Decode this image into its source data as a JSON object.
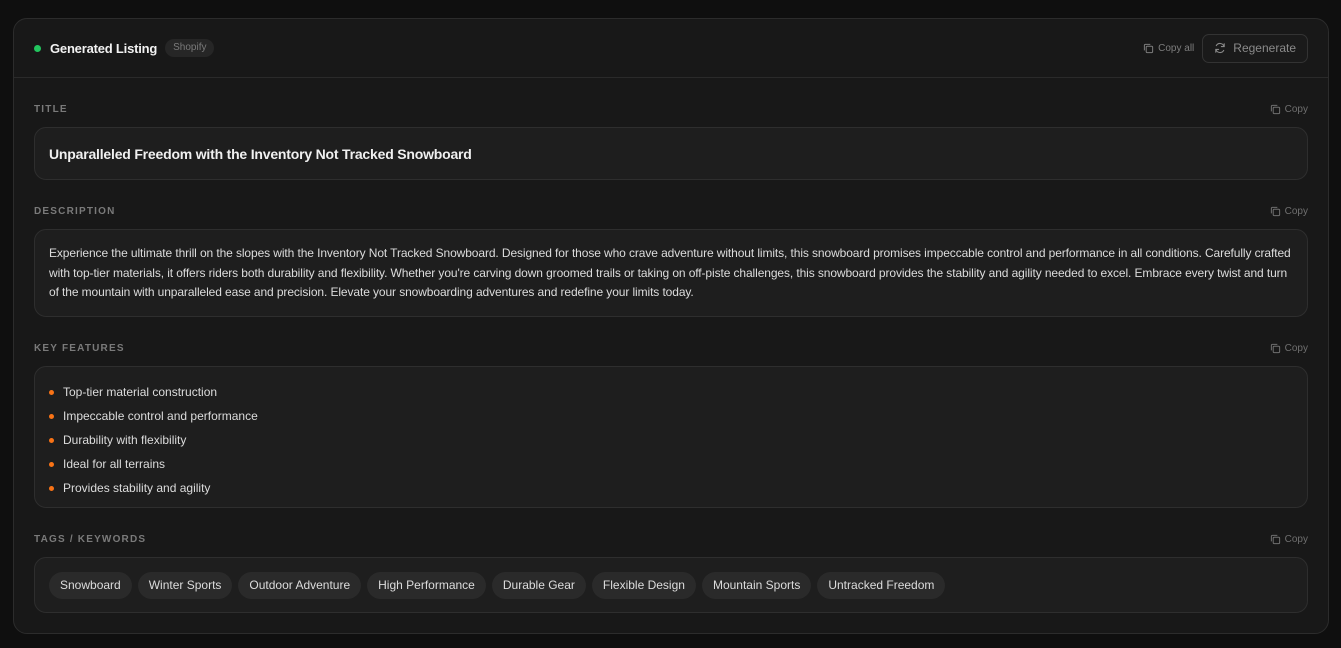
{
  "header": {
    "title": "Generated Listing",
    "badge": "Shopify",
    "copy_all_label": "Copy all",
    "regenerate_label": "Regenerate",
    "status_color": "#22c55e"
  },
  "sections": {
    "title": {
      "label": "TITLE",
      "copy_label": "Copy",
      "value": "Unparalleled Freedom with the Inventory Not Tracked Snowboard"
    },
    "description": {
      "label": "DESCRIPTION",
      "copy_label": "Copy",
      "value": "Experience the ultimate thrill on the slopes with the Inventory Not Tracked Snowboard. Designed for those who crave adventure without limits, this snowboard promises impeccable control and performance in all conditions. Carefully crafted with top-tier materials, it offers riders both durability and flexibility. Whether you're carving down groomed trails or taking on off-piste challenges, this snowboard provides the stability and agility needed to excel. Embrace every twist and turn of the mountain with unparalleled ease and precision. Elevate your snowboarding adventures and redefine your limits today."
    },
    "features": {
      "label": "KEY FEATURES",
      "copy_label": "Copy",
      "items": [
        "Top-tier material construction",
        "Impeccable control and performance",
        "Durability with flexibility",
        "Ideal for all terrains",
        "Provides stability and agility"
      ],
      "bullet_color": "#f97316"
    },
    "tags": {
      "label": "TAGS / KEYWORDS",
      "copy_label": "Copy",
      "items": [
        "Snowboard",
        "Winter Sports",
        "Outdoor Adventure",
        "High Performance",
        "Durable Gear",
        "Flexible Design",
        "Mountain Sports",
        "Untracked Freedom"
      ]
    }
  }
}
